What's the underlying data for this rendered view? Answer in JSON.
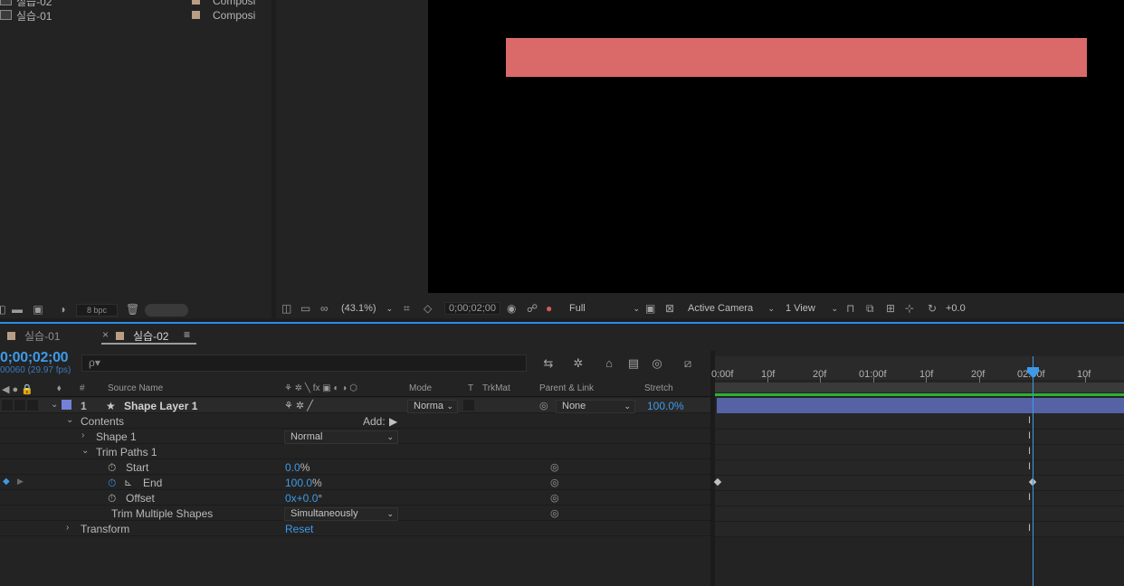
{
  "project": {
    "items": [
      {
        "name": "실습-02",
        "type": "Composi"
      },
      {
        "name": "실습-01",
        "type": "Composi"
      }
    ],
    "bpc_label": "8 bpc"
  },
  "viewer": {
    "shape_color": "#d96a69",
    "zoom": "(43.1%)",
    "timecode": "0;00;02;00",
    "resolution": "Full",
    "camera": "Active Camera",
    "views": "1 View",
    "exposure": "+0.0"
  },
  "timeline": {
    "tabs": [
      {
        "label": "실습-01"
      },
      {
        "label": "실습-02"
      }
    ],
    "close_glyph": "×",
    "menu_glyph": "≡",
    "current_time": "0;00;02;00",
    "frame_info": "00060 (29.97 fps)",
    "search_placeholder": "ρ▾",
    "columns": {
      "number": "#",
      "source_name": "Source Name",
      "mode": "Mode",
      "t": "T",
      "trkmat": "TrkMat",
      "parent": "Parent & Link",
      "stretch": "Stretch"
    },
    "layer": {
      "number": "1",
      "name": "Shape Layer 1",
      "mode": "Norma",
      "parent": "None",
      "stretch": "100.0%"
    },
    "rows": {
      "contents": "Contents",
      "add_label": "Add:",
      "shape1": "Shape 1",
      "shape1_mode": "Normal",
      "trim_paths": "Trim Paths 1",
      "start": "Start",
      "start_value": "0.0",
      "start_unit": "%",
      "end": "End",
      "end_value": "100.0",
      "end_unit": "%",
      "offset": "Offset",
      "offset_value": "0x+0.0",
      "offset_unit": "°",
      "trim_multiple": "Trim Multiple Shapes",
      "trim_multiple_value": "Simultaneously",
      "transform": "Transform",
      "transform_value": "Reset"
    },
    "ruler_labels": [
      "0:00f",
      "10f",
      "20f",
      "01:00f",
      "10f",
      "20f",
      "02:00f",
      "10f"
    ],
    "accent_color": "#3d9ae8",
    "layer_bar_color": "#5563a5",
    "green_line_color": "#2bb232"
  }
}
